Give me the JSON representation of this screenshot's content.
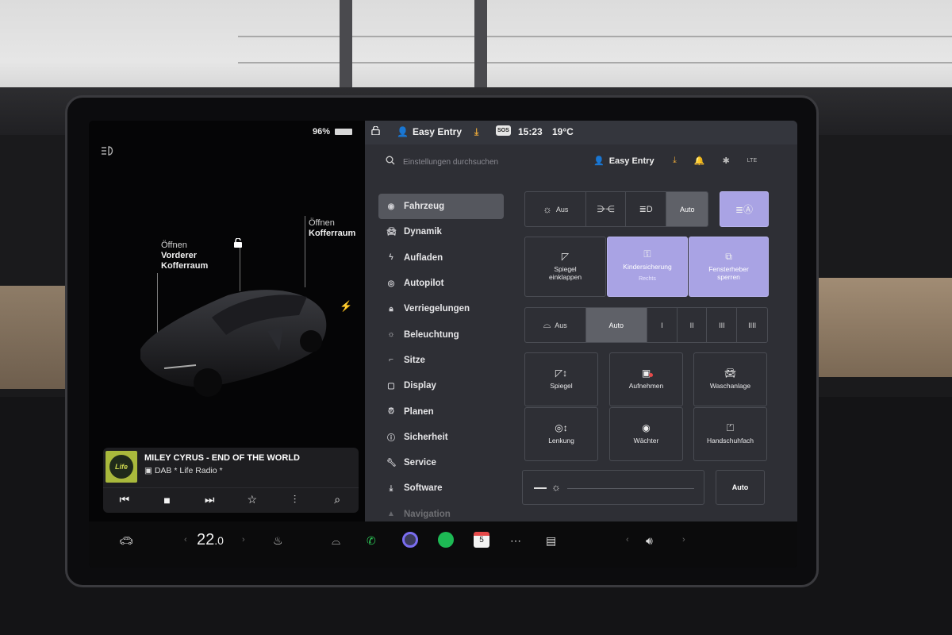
{
  "left_panel": {
    "battery_percent": "96%",
    "frunk": {
      "line1": "Öffnen",
      "line2": "Vorderer",
      "line3": "Kofferraum"
    },
    "trunk": {
      "line1": "Öffnen",
      "line2": "Kofferraum"
    }
  },
  "media": {
    "title": "MILEY CYRUS - END OF THE WORLD",
    "station": "DAB * Life Radio *",
    "album_art_text": "Life"
  },
  "status_bar": {
    "profile": "Easy Entry",
    "time": "15:23",
    "temperature": "19°C",
    "sos": "SOS"
  },
  "search": {
    "placeholder": "Einstellungen durchsuchen",
    "profile": "Easy Entry",
    "lte": "LTE"
  },
  "nav": {
    "items": [
      {
        "label": "Fahrzeug",
        "icon": "toggle-icon"
      },
      {
        "label": "Dynamik",
        "icon": "car-icon"
      },
      {
        "label": "Aufladen",
        "icon": "bolt-icon"
      },
      {
        "label": "Autopilot",
        "icon": "steering-wheel-icon"
      },
      {
        "label": "Verriegelungen",
        "icon": "lock-icon"
      },
      {
        "label": "Beleuchtung",
        "icon": "sun-icon"
      },
      {
        "label": "Sitze",
        "icon": "seat-icon"
      },
      {
        "label": "Display",
        "icon": "display-icon"
      },
      {
        "label": "Planen",
        "icon": "alarm-icon"
      },
      {
        "label": "Sicherheit",
        "icon": "alert-icon"
      },
      {
        "label": "Service",
        "icon": "wrench-icon"
      },
      {
        "label": "Software",
        "icon": "download-icon"
      },
      {
        "label": "Navigation",
        "icon": "navigation-icon"
      }
    ]
  },
  "lights": {
    "off_label": "Aus",
    "auto_label": "Auto",
    "selected": "Auto"
  },
  "tiles_row1": {
    "mirror_fold": "Spiegel einklappen",
    "child_lock": "Kindersicherung",
    "child_lock_sub": "Rechts",
    "window_lock": "Fensterheber sperren"
  },
  "wipers": {
    "off_label": "Aus",
    "auto_label": "Auto",
    "speeds": [
      "I",
      "II",
      "III",
      "IIII"
    ],
    "selected": "Auto"
  },
  "tiles_grid": {
    "mirrors": "Spiegel",
    "record": "Aufnehmen",
    "washer": "Waschanlage",
    "steering": "Lenkung",
    "sentry": "Wächter",
    "glovebox": "Handschuhfach"
  },
  "brightness": {
    "auto_label": "Auto"
  },
  "bottom_bar": {
    "temp_main": "22",
    "temp_decimal": ".0",
    "calendar_day": "5"
  },
  "colors": {
    "accent_lavender": "#a9a3e4",
    "panel_bg": "#2e2f35",
    "download_orange": "#e5a53a",
    "phone_green": "#2ecc59",
    "spotify_green": "#1db954",
    "calendar_red": "#e54a4a"
  }
}
